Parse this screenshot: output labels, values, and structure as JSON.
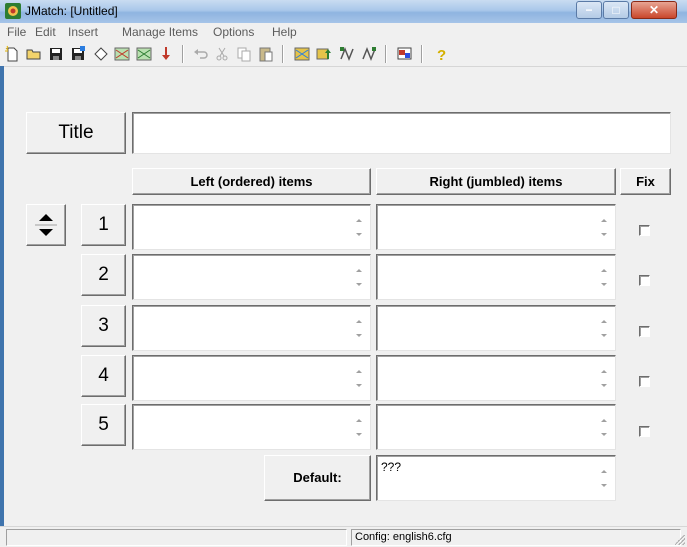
{
  "window": {
    "title": "JMatch: [Untitled]",
    "controls": {
      "minimize": "−",
      "maximize": "□",
      "close": "✕"
    }
  },
  "menu": [
    "File",
    "Edit",
    "Insert",
    "Manage Items",
    "Options",
    "Help"
  ],
  "toolbar": {
    "icons": [
      "new-file-icon",
      "open-folder-icon",
      "save-icon",
      "save-as-icon",
      "clear-icon",
      "web-page-icon",
      "web-page-drag-icon",
      "add-text-icon",
      "undo-icon",
      "cut-icon",
      "copy-icon",
      "paste-icon",
      "export-web-icon",
      "export-upload-icon",
      "shuffle-icon",
      "match-icon",
      "config-icon",
      "help-icon"
    ]
  },
  "title_field": {
    "label": "Title",
    "value": ""
  },
  "columns": {
    "left": "Left (ordered) items",
    "right": "Right (jumbled) items",
    "fix": "Fix"
  },
  "rows": [
    {
      "number": "1",
      "left": "",
      "right": "",
      "fixed": false
    },
    {
      "number": "2",
      "left": "",
      "right": "",
      "fixed": false
    },
    {
      "number": "3",
      "left": "",
      "right": "",
      "fixed": false
    },
    {
      "number": "4",
      "left": "",
      "right": "",
      "fixed": false
    },
    {
      "number": "5",
      "left": "",
      "right": "",
      "fixed": false
    }
  ],
  "default_row": {
    "label": "Default:",
    "value": "???"
  },
  "statusbar": {
    "left": "",
    "config": "Config: english6.cfg"
  },
  "colors": {
    "titlebar": "#a9c7ea",
    "face": "#f0f0f0",
    "close": "#c9462b"
  }
}
